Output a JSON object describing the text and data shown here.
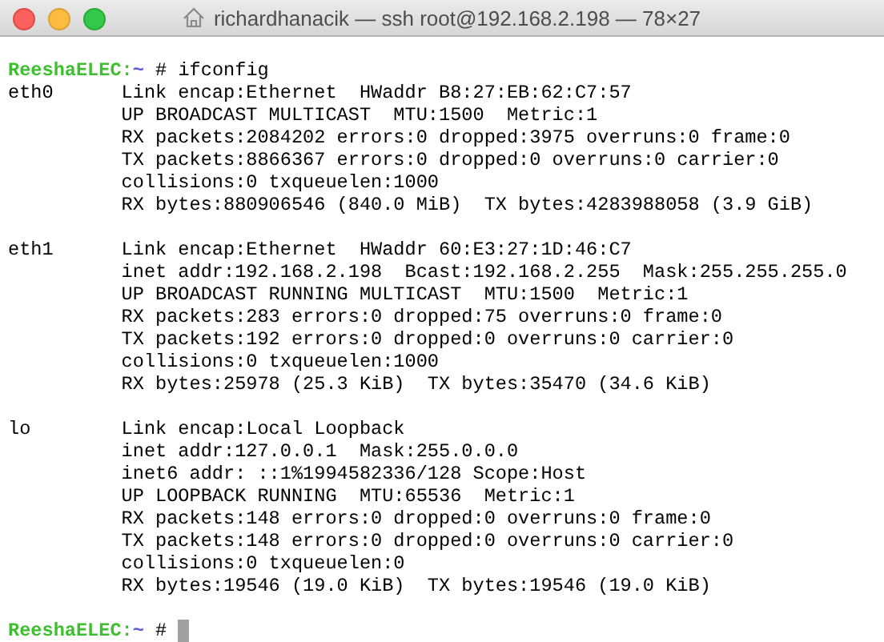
{
  "window": {
    "title": "richardhanacik — ssh root@192.168.2.198 — 78×27"
  },
  "terminal": {
    "blocks": [
      {
        "kind": "prompt",
        "host": "ReeshaELEC:",
        "path": "~",
        "symbol": "#",
        "command": "ifconfig",
        "cursor": false
      },
      {
        "kind": "interface",
        "name": "eth0",
        "lines": [
          "Link encap:Ethernet  HWaddr B8:27:EB:62:C7:57",
          "UP BROADCAST MULTICAST  MTU:1500  Metric:1",
          "RX packets:2084202 errors:0 dropped:3975 overruns:0 frame:0",
          "TX packets:8866367 errors:0 dropped:0 overruns:0 carrier:0",
          "collisions:0 txqueuelen:1000",
          "RX bytes:880906546 (840.0 MiB)  TX bytes:4283988058 (3.9 GiB)"
        ]
      },
      {
        "kind": "interface",
        "name": "eth1",
        "lines": [
          "Link encap:Ethernet  HWaddr 60:E3:27:1D:46:C7",
          "inet addr:192.168.2.198  Bcast:192.168.2.255  Mask:255.255.255.0",
          "UP BROADCAST RUNNING MULTICAST  MTU:1500  Metric:1",
          "RX packets:283 errors:0 dropped:75 overruns:0 frame:0",
          "TX packets:192 errors:0 dropped:0 overruns:0 carrier:0",
          "collisions:0 txqueuelen:1000",
          "RX bytes:25978 (25.3 KiB)  TX bytes:35470 (34.6 KiB)"
        ]
      },
      {
        "kind": "interface",
        "name": "lo",
        "lines": [
          "Link encap:Local Loopback",
          "inet addr:127.0.0.1  Mask:255.0.0.0",
          "inet6 addr: ::1%1994582336/128 Scope:Host",
          "UP LOOPBACK RUNNING  MTU:65536  Metric:1",
          "RX packets:148 errors:0 dropped:0 overruns:0 frame:0",
          "TX packets:148 errors:0 dropped:0 overruns:0 carrier:0",
          "collisions:0 txqueuelen:0",
          "RX bytes:19546 (19.0 KiB)  TX bytes:19546 (19.0 KiB)"
        ]
      },
      {
        "kind": "prompt",
        "host": "ReeshaELEC:",
        "path": "~",
        "symbol": "#",
        "cursor": true
      }
    ]
  }
}
